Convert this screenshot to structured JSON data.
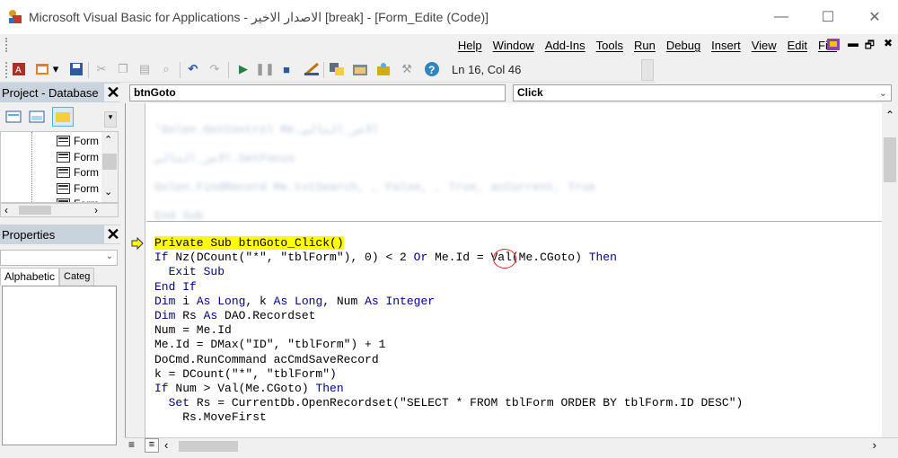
{
  "window": {
    "title": "Microsoft Visual Basic for Applications - الاصدار الاخير [break] - [Form_Edite (Code)]",
    "minimize": "—",
    "maximize": "☐",
    "close": "✕"
  },
  "menu": {
    "items": [
      "Help",
      "Window",
      "Add-Ins",
      "Tools",
      "Run",
      "Debug",
      "Insert",
      "View",
      "Edit",
      "File"
    ],
    "doc_minimize": "▬",
    "doc_restore": "🗗",
    "doc_close": "✖"
  },
  "toolbar": {
    "position": "Ln 16, Col 46"
  },
  "project_pane": {
    "title": "Project - Database",
    "tree_items": [
      "Form",
      "Form",
      "Form",
      "Form",
      "Form"
    ]
  },
  "properties_pane": {
    "title": "Properties",
    "tab_alphabetic": "Alphabetic",
    "tab_categorized": "Categ"
  },
  "code_window": {
    "object_combo": "btnGoto",
    "procedure_combo": "Click",
    "faded_lines": [
      "'Golen.GotControl Me.الامر_التالي",
      "الامر_التالي.SetFocus",
      "Golen.FindRecord Me.txtSearch, , False, , True, acCurrent, True",
      "End Sub"
    ],
    "lines": [
      [
        {
          "t": "Private Sub btnGoto_Click()",
          "c": "hl"
        }
      ],
      [
        {
          "t": "If",
          "c": "kw"
        },
        {
          "t": " Nz(DCount(\"*\", \"tblForm\"), 0) < 2 "
        },
        {
          "t": "Or",
          "c": "kw"
        },
        {
          "t": " Me.Id = Val(Me.CGoto) "
        },
        {
          "t": "Then",
          "c": "kw"
        }
      ],
      [
        {
          "t": "  Exit Sub",
          "c": "kw"
        }
      ],
      [
        {
          "t": "End If",
          "c": "kw"
        }
      ],
      [
        {
          "t": "Dim",
          "c": "kw"
        },
        {
          "t": " i "
        },
        {
          "t": "As Long",
          "c": "kw"
        },
        {
          "t": ", k "
        },
        {
          "t": "As Long",
          "c": "kw"
        },
        {
          "t": ", Num "
        },
        {
          "t": "As Integer",
          "c": "kw"
        }
      ],
      [
        {
          "t": "Dim",
          "c": "kw"
        },
        {
          "t": " Rs "
        },
        {
          "t": "As",
          "c": "kw"
        },
        {
          "t": " DAO.Recordset"
        }
      ],
      [
        {
          "t": "Num = Me.Id"
        }
      ],
      [
        {
          "t": "Me.Id = DMax(\"ID\", \"tblForm\") + 1"
        }
      ],
      [
        {
          "t": "DoCmd.RunCommand acCmdSaveRecord"
        }
      ],
      [
        {
          "t": "k = DCount(\"*\", \"tblForm\")"
        }
      ],
      [
        {
          "t": "If",
          "c": "kw"
        },
        {
          "t": " Num > Val(Me.CGoto) "
        },
        {
          "t": "Then",
          "c": "kw"
        }
      ],
      [
        {
          "t": "  "
        },
        {
          "t": "Set",
          "c": "kw"
        },
        {
          "t": " Rs = CurrentDb.OpenRecordset(\"SELECT * FROM tblForm ORDER BY tblForm.ID DESC\")"
        }
      ],
      [
        {
          "t": "    Rs.MoveFirst"
        }
      ]
    ]
  },
  "colors": {
    "keyword": "#00008b",
    "highlight": "#ffff00",
    "pane_title": "#c9d3de"
  }
}
